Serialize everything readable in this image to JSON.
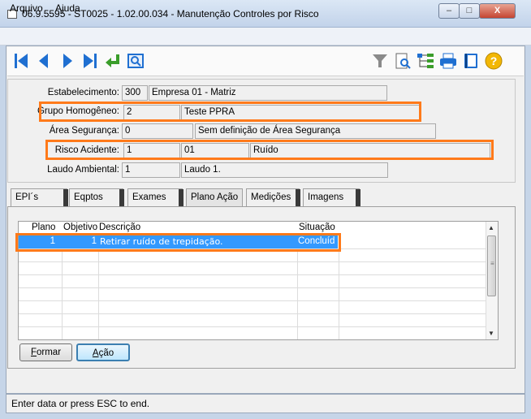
{
  "window": {
    "title": "06.9.5595 - ST0025 - 1.02.00.034 - Manutenção Controles por Risco",
    "min": "–",
    "max": "□",
    "close": "X"
  },
  "menu": [
    "Arquivo",
    "Ajuda"
  ],
  "toolbar": {
    "nav": [
      "first-icon",
      "previous-icon",
      "next-icon",
      "last-icon",
      "return-icon",
      "zoom-icon"
    ],
    "right": [
      "filter-icon",
      "preview-icon",
      "tree-icon",
      "print-icon",
      "book-icon",
      "help-icon"
    ],
    "accent": "#1f6fd1",
    "help_color": "#f2b705"
  },
  "form": {
    "estabelecimento": {
      "label": "Estabelecimento:",
      "code": "300",
      "desc": "Empresa 01 - Matriz"
    },
    "grupo": {
      "label": "Grupo Homogêneo:",
      "code": "2",
      "desc": "Teste PPRA"
    },
    "area": {
      "label": "Área Segurança:",
      "code": "0",
      "desc": "Sem definição de Área Segurança"
    },
    "risco": {
      "label": "Risco Acidente:",
      "code": "1",
      "code2": "01",
      "desc": "Ruído"
    },
    "laudo": {
      "label": "Laudo Ambiental:",
      "code": "1",
      "desc": "Laudo 1."
    }
  },
  "tabs": [
    "EPI´s",
    "Eqptos",
    "Exames",
    "Plano Ação",
    "Medições",
    "Imagens"
  ],
  "grid": {
    "headers": [
      "Plano",
      "Objetivo",
      "Descrição",
      "Situação"
    ],
    "rows": [
      {
        "plano": "1",
        "objetivo": "1",
        "descricao": "Retirar ruído de trepidação.",
        "situacao": "Concluíd"
      }
    ]
  },
  "buttons": {
    "formar": "ormar",
    "formar_key": "F",
    "acao": "ção",
    "acao_key": "A"
  },
  "status": "Enter data or press ESC to end.",
  "highlight_color": "#ff7a1a"
}
